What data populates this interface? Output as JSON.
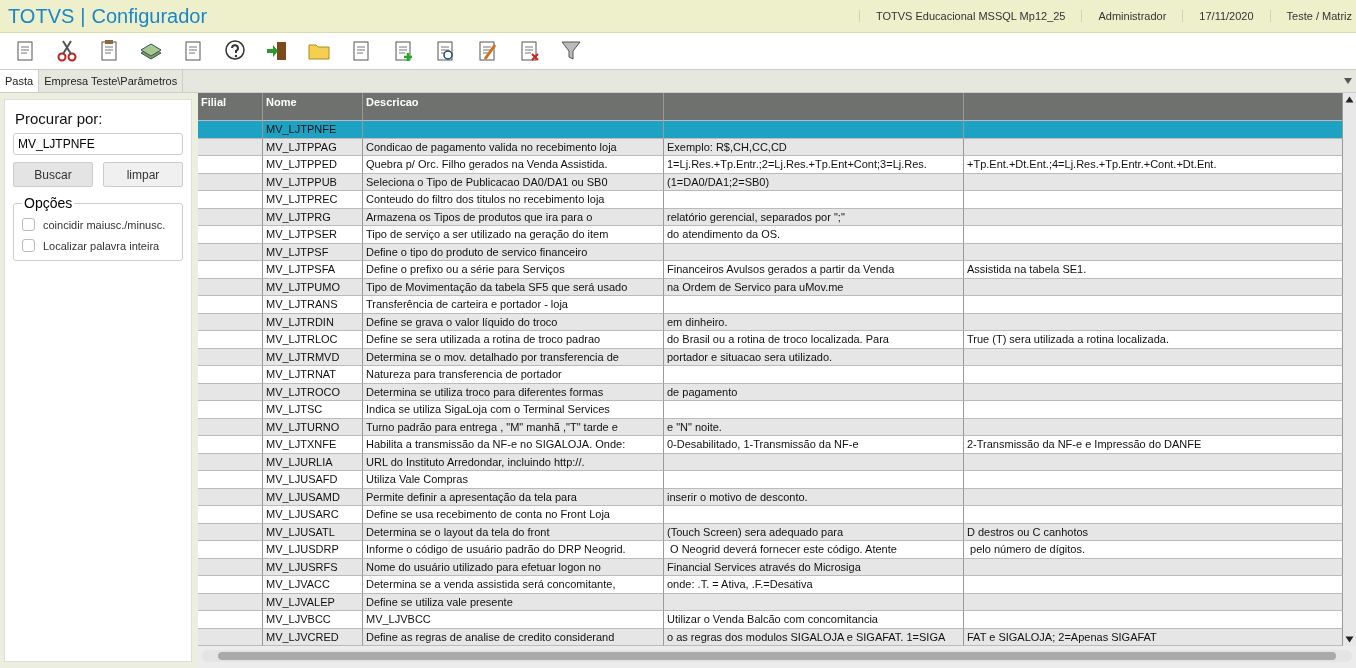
{
  "title_bar": {
    "logo": "TOTVS",
    "separator": "|",
    "app_name": "Configurador",
    "environment": "TOTVS Educacional MSSQL Mp12_25",
    "user": "Administrador",
    "date": "17/11/2020",
    "branch": "Teste / Matriz"
  },
  "tabs": [
    {
      "label": "Pasta",
      "selected": true
    },
    {
      "label": "Empresa Teste\\Parâmetros",
      "selected": false
    }
  ],
  "search": {
    "label": "Procurar por:",
    "value": "MV_LJTPNFE",
    "buttons": [
      "Buscar",
      "limpar"
    ],
    "options_title": "Opções",
    "options": [
      {
        "label": "coincidir maiusc./minusc.",
        "checked": false
      },
      {
        "label": "Localizar palavra inteira",
        "checked": false
      }
    ]
  },
  "table": {
    "columns": [
      "Filial",
      "Nome",
      "Descricao"
    ],
    "rows": [
      {
        "nome": "MV_LJTPNFE",
        "selected": true
      },
      {
        "nome": "MV_LJTPPAG",
        "descricao": "Condicao de pagamento valida no recebimento loja",
        "column_4": "Exemplo: R$,CH,CC,CD",
        "selected": false
      },
      {
        "nome": "MV_LJTPPED",
        "descricao": "Quebra p/ Orc. Filho gerados na Venda Assistida.",
        "column_4": "1=Lj.Res.+Tp.Entr.;2=Lj.Res.+Tp.Ent+Cont;3=Lj.Res.",
        "column_5": "+Tp.Ent.+Dt.Ent.;4=Lj.Res.+Tp.Entr.+Cont.+Dt.Ent.",
        "selected": false
      },
      {
        "nome": "MV_LJTPPUB",
        "descricao": "Seleciona o Tipo de Publicacao DA0/DA1 ou SB0",
        "column_4": "(1=DA0/DA1;2=SB0)",
        "selected": false
      },
      {
        "nome": "MV_LJTPREC",
        "descricao": "Conteudo do filtro dos titulos no recebimento loja",
        "selected": false
      },
      {
        "nome": "MV_LJTPRG",
        "descricao": "Armazena os Tipos de produtos que ira para o",
        "column_4": "relatório gerencial, separados por \";\"",
        "selected": false
      },
      {
        "nome": "MV_LJTPSER",
        "descricao": "Tipo de serviço a ser utilizado na geração do item",
        "column_4": "do atendimento da OS.",
        "selected": false
      },
      {
        "nome": "MV_LJTPSF",
        "descricao": "Define o tipo do produto de servico financeiro",
        "selected": false
      },
      {
        "nome": "MV_LJTPSFA",
        "descricao": "Define o prefixo ou a série para Serviços",
        "column_4": "Financeiros Avulsos gerados a partir da Venda",
        "column_5": "Assistida na tabela SE1.",
        "selected": false
      },
      {
        "nome": "MV_LJTPUMO",
        "descricao": "Tipo de Movimentação da tabela SF5 que será usado",
        "column_4": "na Ordem de Servico para uMov.me",
        "selected": false
      },
      {
        "nome": "MV_LJTRANS",
        "descricao": "Transferência de carteira e portador - loja",
        "selected": false
      },
      {
        "nome": "MV_LJTRDIN",
        "descricao": "Define se grava o valor líquido do troco",
        "column_4": "em dinheiro.",
        "selected": false
      },
      {
        "nome": "MV_LJTRLOC",
        "descricao": "Define se sera utilizada a rotina de troco padrao",
        "column_4": "do Brasil ou a rotina de troco localizada. Para",
        "column_5": "True (T) sera utilizada a rotina localizada.",
        "selected": false
      },
      {
        "nome": "MV_LJTRMVD",
        "descricao": "Determina se o mov. detalhado por transferencia de",
        "column_4": "portador e situacao sera utilizado.",
        "selected": false
      },
      {
        "nome": "MV_LJTRNAT",
        "descricao": "Natureza para transferencia de portador",
        "selected": false
      },
      {
        "nome": "MV_LJTROCO",
        "descricao": "Determina se utiliza troco para diferentes formas",
        "column_4": "de pagamento",
        "selected": false
      },
      {
        "nome": "MV_LJTSC",
        "descricao": "Indica se utiliza SigaLoja com o Terminal Services",
        "selected": false
      },
      {
        "nome": "MV_LJTURNO",
        "descricao": "Turno padrão para entrega , \"M\" manhã ,\"T\" tarde e",
        "column_4": "e \"N\" noite.",
        "selected": false
      },
      {
        "nome": "MV_LJTXNFE",
        "descricao": "Habilita a transmissão da NF-e no SIGALOJA. Onde:",
        "column_4": "0-Desabilitado, 1-Transmissão da NF-e",
        "column_5": "2-Transmissão da NF-e e Impressão do DANFE",
        "selected": false
      },
      {
        "nome": "MV_LJURLIA",
        "descricao": "URL do Instituto Arredondar, incluindo http://.",
        "selected": false
      },
      {
        "nome": "MV_LJUSAFD",
        "descricao": "Utiliza Vale Compras",
        "selected": false
      },
      {
        "nome": "MV_LJUSAMD",
        "descricao": "Permite definir a apresentação da tela para",
        "column_4": "inserir o motivo de desconto.",
        "selected": false
      },
      {
        "nome": "MV_LJUSARC",
        "descricao": "Define se usa recebimento de conta no Front Loja",
        "selected": false
      },
      {
        "nome": "MV_LJUSATL",
        "descricao": "Determina se o layout da tela do front",
        "column_4": "(Touch Screen) sera adequado para",
        "column_5": "D destros ou C canhotos",
        "selected": false
      },
      {
        "nome": "MV_LJUSDRP",
        "descricao": "Informe o código de usuário padrão do DRP Neogrid.",
        "column_4": " O Neogrid deverá fornecer este código. Atente",
        "column_5": " pelo número de dígitos.",
        "selected": false
      },
      {
        "nome": "MV_LJUSRFS",
        "descricao": "Nome do usuário utilizado para efetuar logon no",
        "column_4": "Financial Services através do Microsiga",
        "selected": false
      },
      {
        "nome": "MV_LJVACC",
        "descricao": "Determina se a venda assistida será concomitante,",
        "column_4": "onde: .T. = Ativa, .F.=Desativa",
        "selected": false
      },
      {
        "nome": "MV_LJVALEP",
        "descricao": "Define se utiliza vale presente",
        "selected": false
      },
      {
        "nome": "MV_LJVBCC",
        "descricao": "MV_LJVBCC",
        "column_4": "Utilizar o Venda Balcão com concomitancia",
        "selected": false
      },
      {
        "nome": "MV_LJVCRED",
        "descricao": "Define as regras de analise de credito considerand",
        "column_4": "o as regras dos modulos SIGALOJA e SIGAFAT. 1=SIGA",
        "column_5": "FAT e SIGALOJA; 2=Apenas SIGAFAT",
        "selected": false
      }
    ]
  }
}
